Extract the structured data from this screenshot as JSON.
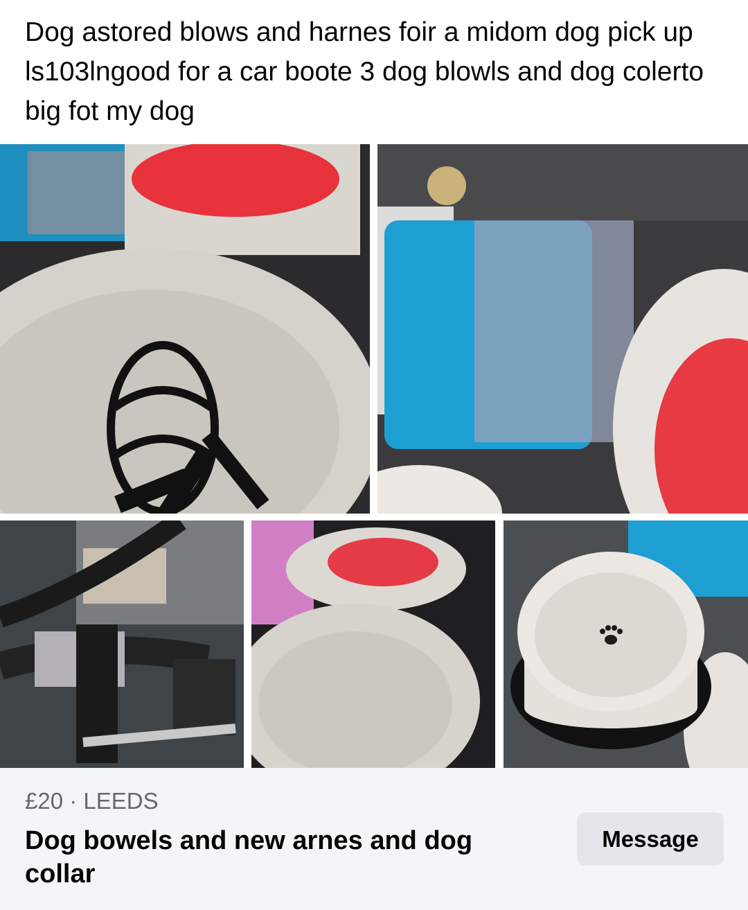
{
  "post": {
    "text": "Dog astored blows and harnes foir a midom dog pick up ls103lngood for a car boote 3 dog blowls and dog colerto big fot my dog"
  },
  "photos": [
    {
      "subject": "black basket muzzle on white bowl"
    },
    {
      "subject": "blue lick mat with red slow feeder in white bowl"
    },
    {
      "subject": "black and grey dog harness with collar"
    },
    {
      "subject": "white bowl with red slow feeder insert"
    },
    {
      "subject": "white dog bowl with paw print"
    }
  ],
  "listing": {
    "price": "£20",
    "separator": "·",
    "location": "LEEDS",
    "title": "Dog bowels and new arnes and dog collar",
    "message_label": "Message"
  },
  "colors": {
    "text": "#050505",
    "secondary_text": "#65676b",
    "bar_background": "#f4f5f7",
    "button_background": "#e4e6eb"
  }
}
